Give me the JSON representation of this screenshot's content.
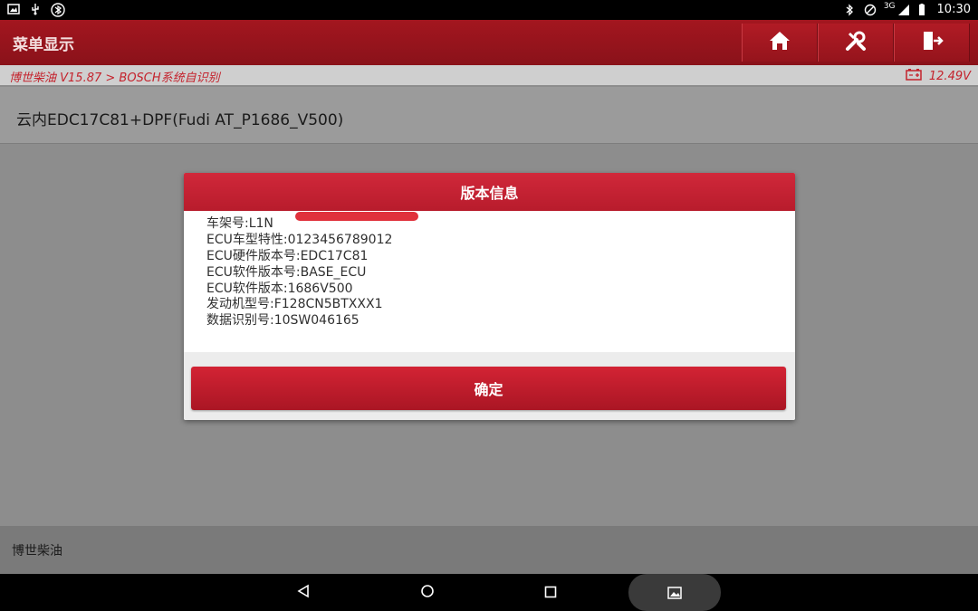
{
  "status_bar": {
    "time": "10:30",
    "network": "3G",
    "left_icons": [
      "image-icon",
      "usb-icon",
      "bluetooth-app-icon"
    ],
    "right_icons": [
      "bluetooth-icon",
      "do-not-disturb-icon",
      "signal-icon",
      "battery-icon"
    ]
  },
  "app_bar": {
    "title": "菜单显示",
    "buttons": [
      "home-icon",
      "diagnose-icon",
      "exit-icon"
    ]
  },
  "breadcrumb": {
    "text": "博世柴油 V15.87 > BOSCH系统自识别",
    "voltage": "12.49V"
  },
  "vehicle": {
    "name": "云内EDC17C81+DPF(Fudi AT_P1686_V500)"
  },
  "dialog": {
    "title": "版本信息",
    "lines": [
      "车架号:L1N",
      "ECU车型特性:0123456789012",
      "ECU硬件版本号:EDC17C81",
      "ECU软件版本号:BASE_ECU",
      "ECU软件版本:1686V500",
      "发动机型号:F128CN5BTXXX1",
      "数据识别号:10SW046165"
    ],
    "ok_label": "确定"
  },
  "bottom_bar": {
    "label": "博世柴油"
  },
  "colors": {
    "accent": "#b81c2c",
    "header": "#9c151e",
    "breadcrumb_text": "#c4222c"
  }
}
